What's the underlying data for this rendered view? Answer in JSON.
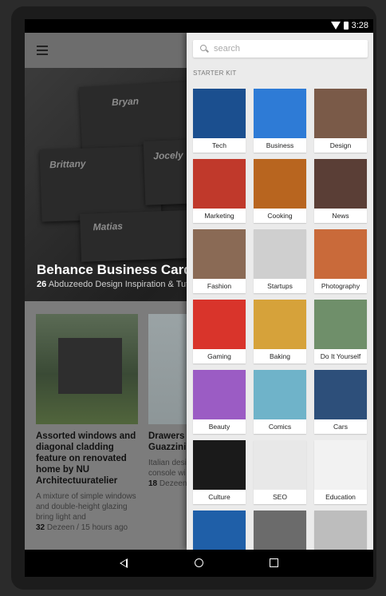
{
  "status": {
    "time": "3:28"
  },
  "hero": {
    "cards": [
      "Bryan",
      "Brittany",
      "Jocely",
      "Matias"
    ],
    "title": "Behance Business Cards",
    "count": "26",
    "source": "Abduzeedo Design Inspiration & Tut"
  },
  "articles": [
    {
      "title": "Assorted windows and diagonal cladding feature on renovated home by NU Architectuuratelier",
      "desc": "A mixture of simple windows and double-height glazing bring light and",
      "count": "32",
      "meta": "Dezeen / 15 hours ago"
    },
    {
      "title": "Drawers s surface o Guazzini' desk",
      "desc": "Italian desi Guazzini ha console wi slide along",
      "count": "18",
      "meta": "Dezeen"
    }
  ],
  "drawer": {
    "search_placeholder": "search",
    "section_label": "STARTER KIT",
    "categories": [
      {
        "label": "Tech",
        "color": "#1b4f8f"
      },
      {
        "label": "Business",
        "color": "#2e7bd6"
      },
      {
        "label": "Design",
        "color": "#7a5a48"
      },
      {
        "label": "Marketing",
        "color": "#c0392b"
      },
      {
        "label": "Cooking",
        "color": "#b8651f"
      },
      {
        "label": "News",
        "color": "#5a3e36"
      },
      {
        "label": "Fashion",
        "color": "#8a6a55"
      },
      {
        "label": "Startups",
        "color": "#cfcfcf"
      },
      {
        "label": "Photography",
        "color": "#c96a3a"
      },
      {
        "label": "Gaming",
        "color": "#d9342b"
      },
      {
        "label": "Baking",
        "color": "#d6a23a"
      },
      {
        "label": "Do It Yourself",
        "color": "#6f8f6a"
      },
      {
        "label": "Beauty",
        "color": "#9b5cc4"
      },
      {
        "label": "Comics",
        "color": "#6fb3c9"
      },
      {
        "label": "Cars",
        "color": "#2d4f7a"
      },
      {
        "label": "Culture",
        "color": "#1a1a1a"
      },
      {
        "label": "SEO",
        "color": "#e8e8e8"
      },
      {
        "label": "Education",
        "color": "#f2f2f2"
      },
      {
        "label": "",
        "color": "#1f5fa8"
      },
      {
        "label": "",
        "color": "#6b6b6b"
      },
      {
        "label": "",
        "color": "#bdbdbd"
      }
    ]
  }
}
